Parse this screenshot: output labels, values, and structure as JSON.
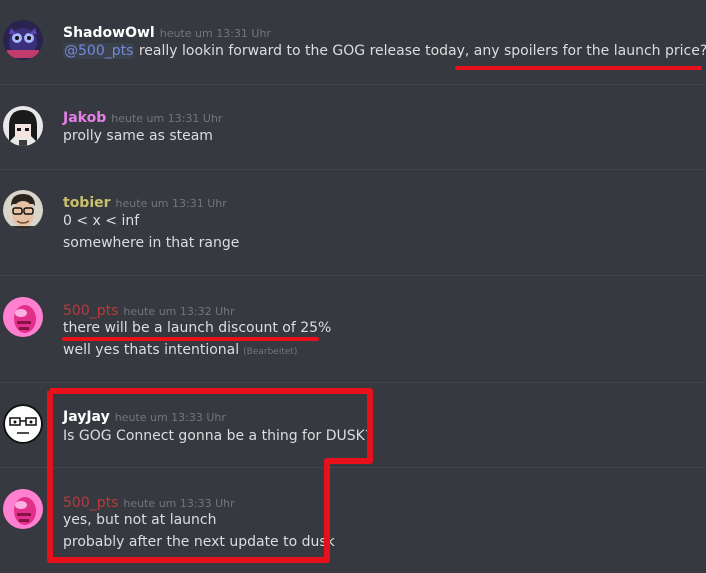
{
  "messages": [
    {
      "username": "ShadowOwl",
      "timestamp": "heute um 13:31 Uhr",
      "mention": "@500_pts",
      "text": " really lookin forward to the GOG release today, any spoilers for the launch price?",
      "emoji": "eyes"
    },
    {
      "username": "Jakob",
      "timestamp": "heute um 13:31 Uhr",
      "lines": [
        "prolly same as steam"
      ]
    },
    {
      "username": "tobier",
      "timestamp": "heute um 13:31 Uhr",
      "lines": [
        "0 < x < inf",
        "somewhere in that range"
      ]
    },
    {
      "username": "500_pts",
      "timestamp": "heute um 13:32 Uhr",
      "lines": [
        "there will be a launch discount of 25%",
        "well yes thats intentional"
      ],
      "edited": "(Bearbeitet)"
    },
    {
      "username": "JayJay",
      "timestamp": "heute um 13:33 Uhr",
      "lines": [
        "Is GOG Connect gonna be a thing for DUSK?"
      ]
    },
    {
      "username": "500_pts",
      "timestamp": "heute um 13:33 Uhr",
      "lines": [
        "yes, but not at launch",
        "probably after the next update to dusk"
      ]
    }
  ],
  "colors": {
    "background": "#36393f",
    "annotation_red": "#e8101a",
    "mention": "#7289da"
  }
}
